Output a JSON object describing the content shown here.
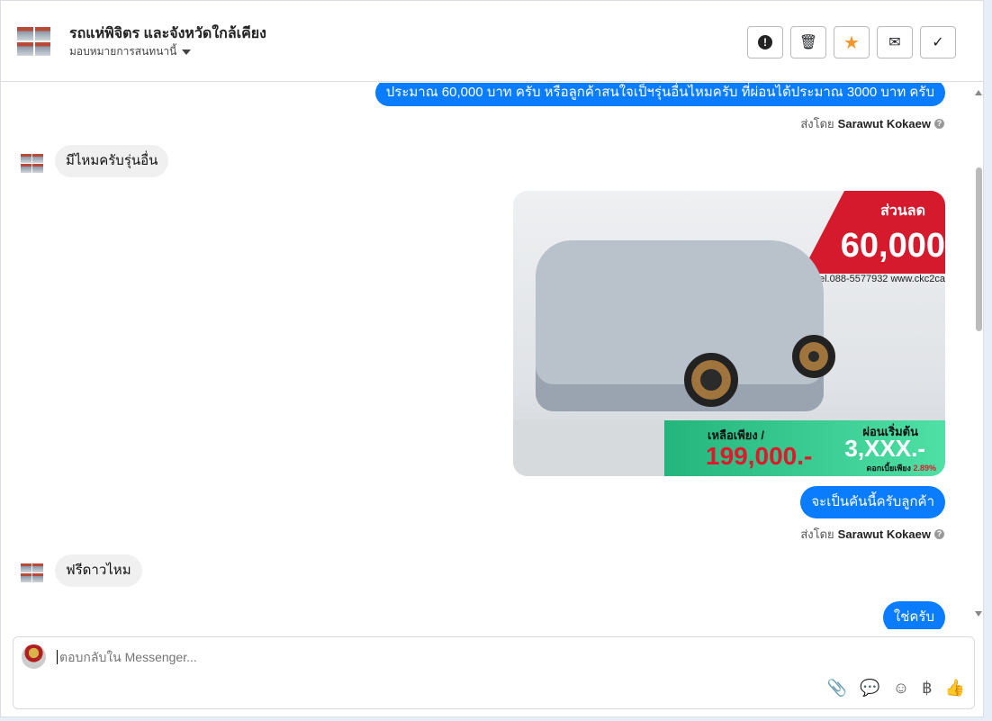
{
  "header": {
    "title": "รถแห่พิจิตร และจังหวัดใกล้เคียง",
    "assign_label": "มอบหมายการสนทนานี้",
    "buttons": [
      {
        "name": "report",
        "icon": "exclamation-icon"
      },
      {
        "name": "delete",
        "icon": "trash-icon"
      },
      {
        "name": "star",
        "icon": "star-icon",
        "color": "#f5962a"
      },
      {
        "name": "mark-unread",
        "icon": "envelope-icon"
      },
      {
        "name": "done",
        "icon": "check-icon"
      }
    ]
  },
  "messages": {
    "m1": "ประมาณ 60,000 บาท ครับ หรือลูกค้าสนใจเป็ฯรุ่นอื่นไหมครับ ที่ผ่อนได้ประมาณ 3000 บาท ครับ",
    "sent_by_prefix": "ส่งโดย",
    "sender": "Sarawut Kokaew",
    "m2": "มีไหมครับรุ่นอื่น",
    "image": {
      "discount_label": "ส่วนลด",
      "discount": "60,000",
      "contact": "Tel.088-5577932   www.ckc2ca",
      "price_label": "เหลือเพียง /",
      "price": "199,000.-",
      "installment_label": "ผ่อนเริ่มต้น",
      "installment": "3,XXX.-",
      "interest_label": "ดอกเบี้ยเพียง",
      "interest": "2.89%"
    },
    "m3": "จะเป็นคันนี้ครับลูกค้า",
    "m4": "ฟรีดาวไหม",
    "m5": "ใช่ครับ"
  },
  "composer": {
    "placeholder": "ตอบกลับใน Messenger...",
    "currency": "฿"
  },
  "colors": {
    "accent": "#0a7cff",
    "star": "#f5962a"
  }
}
